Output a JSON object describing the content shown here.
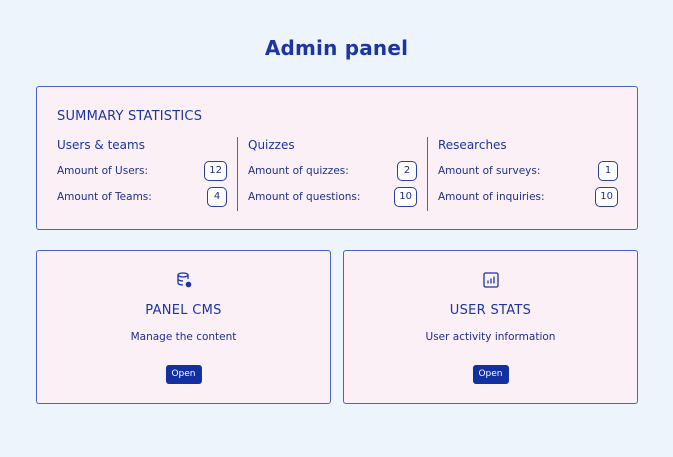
{
  "header": {
    "title": "Admin panel"
  },
  "summary": {
    "heading": "SUMMARY STATISTICS",
    "groups": [
      {
        "title": "Users & teams",
        "rows": [
          {
            "label": "Amount of Users:",
            "value": "12"
          },
          {
            "label": "Amount of Teams:",
            "value": "4"
          }
        ]
      },
      {
        "title": "Quizzes",
        "rows": [
          {
            "label": "Amount of quizzes:",
            "value": "2"
          },
          {
            "label": "Amount of questions:",
            "value": "10"
          }
        ]
      },
      {
        "title": "Researches",
        "rows": [
          {
            "label": "Amount of surveys:",
            "value": "1"
          },
          {
            "label": "Amount of inquiries:",
            "value": "10"
          }
        ]
      }
    ]
  },
  "cards": [
    {
      "icon": "database-settings-icon",
      "title": "PANEL CMS",
      "description": "Manage the content",
      "button_label": "Open"
    },
    {
      "icon": "bar-chart-icon",
      "title": "USER STATS",
      "description": "User activity information",
      "button_label": "Open"
    }
  ],
  "colors": {
    "background": "#edf4fb",
    "card_background": "#fbf0f5",
    "accent": "#1c34a6",
    "button": "#1230a3",
    "border": "#4a63c9"
  }
}
